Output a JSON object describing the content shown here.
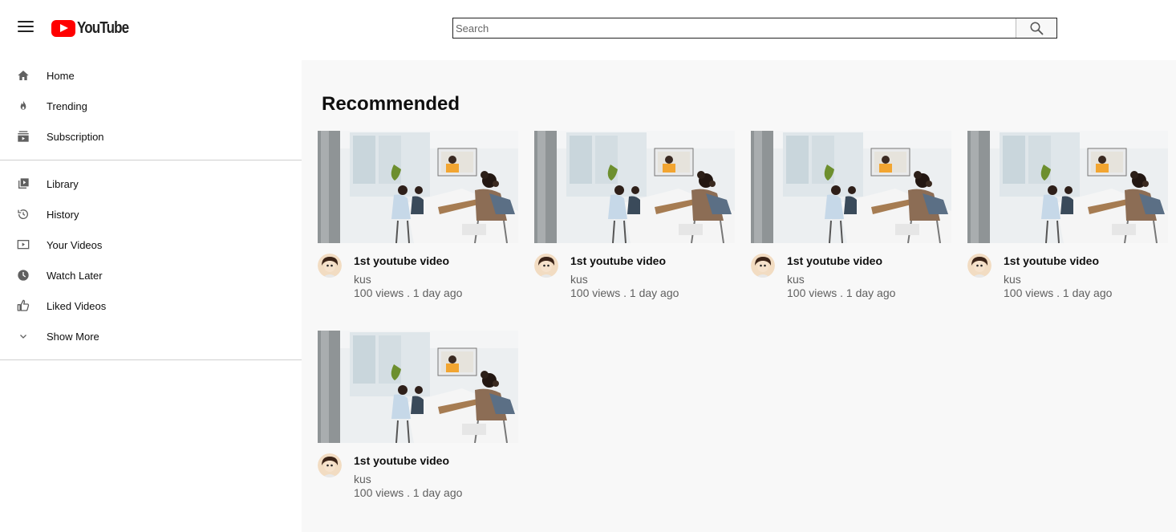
{
  "header": {
    "logo_text": "YouTube",
    "search": {
      "placeholder": "Search",
      "value": ""
    }
  },
  "sidebar": {
    "groups": [
      [
        {
          "label": "Home",
          "icon": "home-icon"
        },
        {
          "label": "Trending",
          "icon": "fire-icon"
        },
        {
          "label": "Subscription",
          "icon": "subscriptions-icon"
        }
      ],
      [
        {
          "label": "Library",
          "icon": "library-icon"
        },
        {
          "label": "History",
          "icon": "history-icon"
        },
        {
          "label": "Your Videos",
          "icon": "your-videos-icon"
        },
        {
          "label": "Watch Later",
          "icon": "clock-icon"
        },
        {
          "label": "Liked Videos",
          "icon": "thumbs-up-icon"
        },
        {
          "label": "Show More",
          "icon": "chevron-down-icon"
        }
      ]
    ]
  },
  "main": {
    "section_title": "Recommended",
    "videos": [
      {
        "title": "1st youtube video",
        "channel": "kus",
        "meta": "100 views . 1 day ago"
      },
      {
        "title": "1st youtube video",
        "channel": "kus",
        "meta": "100 views . 1 day ago"
      },
      {
        "title": "1st youtube video",
        "channel": "kus",
        "meta": "100 views . 1 day ago"
      },
      {
        "title": "1st youtube video",
        "channel": "kus",
        "meta": "100 views . 1 day ago"
      },
      {
        "title": "1st youtube video",
        "channel": "kus",
        "meta": "100 views . 1 day ago"
      }
    ]
  },
  "colors": {
    "brand_red": "#ff0000",
    "main_background": "#f8f8f8",
    "secondary_text": "#606060"
  }
}
